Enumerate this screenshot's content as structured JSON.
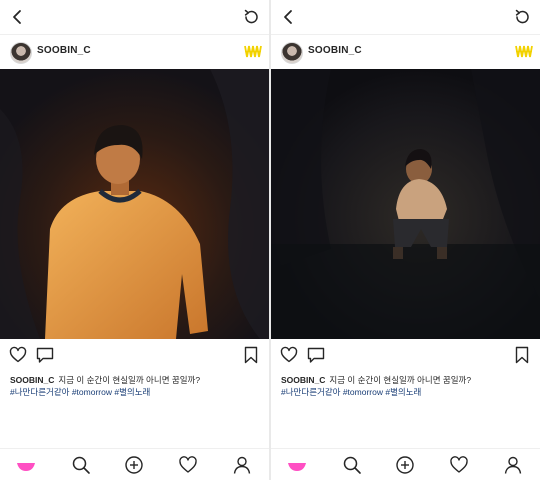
{
  "screens": [
    {
      "username": "SOOBIN_C",
      "caption": {
        "user": "SOOBIN_C",
        "text": "지금 이 순간이 현실일까 아니면 꿈일까?",
        "hashtags": "#나만다른거같아 #tomorrow #별의노래"
      }
    },
    {
      "username": "SOOBIN_C",
      "caption": {
        "user": "SOOBIN_C",
        "text": "지금 이 순간이 현실일까 아니면 꿈일까?",
        "hashtags": "#나만다른거같아 #tomorrow #별의노래"
      }
    }
  ],
  "icons": {
    "top": [
      "back-arrow-icon",
      "refresh-icon"
    ],
    "header_logo": "yellow-wave-logo",
    "post_actions": [
      "heart-icon",
      "comment-icon",
      "bookmark-icon"
    ],
    "bottom_nav": [
      "home-pink-icon",
      "search-icon",
      "add-icon",
      "activity-heart-icon",
      "profile-icon"
    ]
  },
  "colors": {
    "accent_pink": "#ff4fc3",
    "logo_yellow": "#f2d200",
    "hashtag_blue": "#1b3f77",
    "text": "#262626"
  }
}
